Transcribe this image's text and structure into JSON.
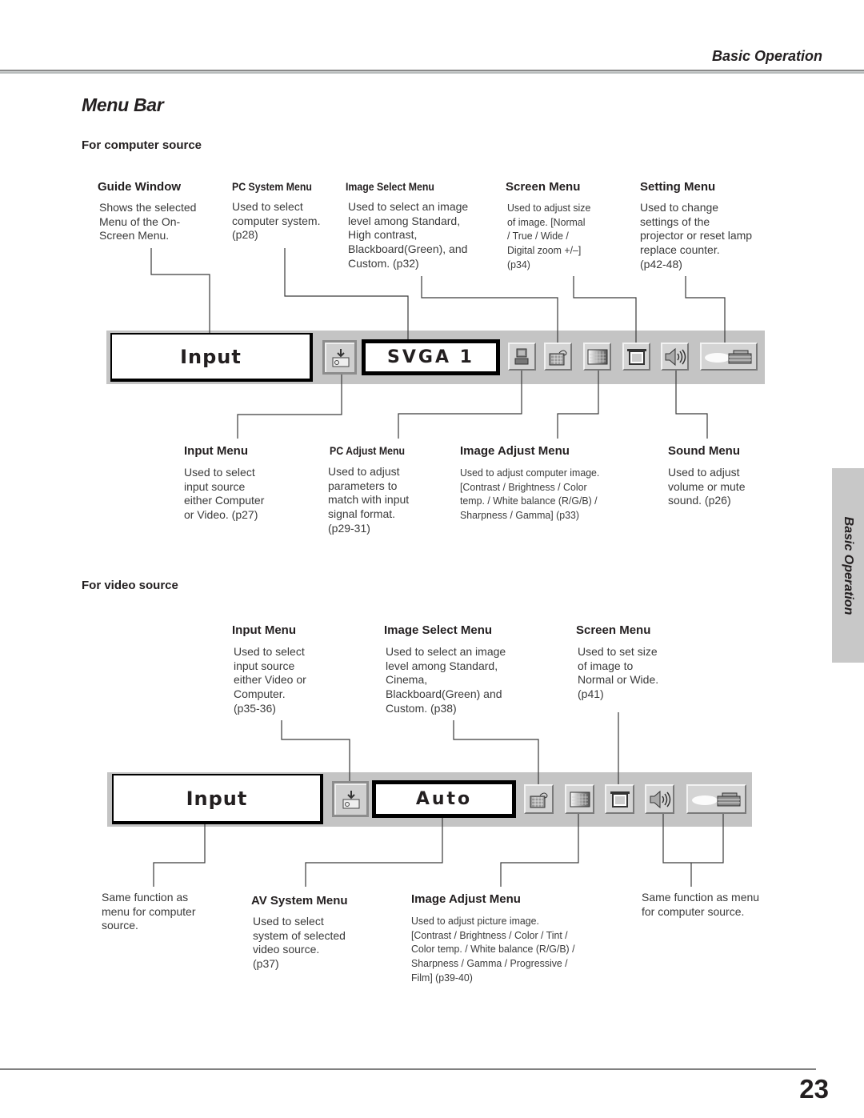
{
  "header": {
    "section": "Basic Operation"
  },
  "page_title": "Menu Bar",
  "side_tab": "Basic Operation",
  "page_number": "23",
  "computer": {
    "title": "For computer source",
    "top_items": [
      {
        "heading": "Guide Window",
        "desc": "Shows the selected\nMenu of the On-\nScreen Menu."
      },
      {
        "heading": "PC System Menu",
        "desc": "Used to select\ncomputer system.\n(p28)"
      },
      {
        "heading": "Image Select Menu",
        "desc": "Used to select  an image\nlevel among Standard,\nHigh contrast,\nBlackboard(Green), and\nCustom.  (p32)"
      },
      {
        "heading": "Screen Menu",
        "desc": "Used to adjust size\nof image.  [Normal\n/ True / Wide /\nDigital zoom +/–]\n(p34)"
      },
      {
        "heading": "Setting Menu",
        "desc": "Used to change\nsettings of the\nprojector or reset  lamp\nreplace counter.\n(p42-48)"
      }
    ],
    "bottom_items": [
      {
        "heading": "Input Menu",
        "desc": "Used to select\ninput source\neither Computer\nor Video.  (p27)"
      },
      {
        "heading": "PC Adjust Menu",
        "desc": "Used to adjust\nparameters to\nmatch with input\nsignal format.\n(p29-31)"
      },
      {
        "heading": "Image Adjust Menu",
        "desc": "Used to adjust computer image.\n[Contrast / Brightness / Color\ntemp. /  White balance (R/G/B) /\nSharpness /  Gamma]   (p33)"
      },
      {
        "heading": "Sound Menu",
        "desc": "Used to adjust\nvolume or mute\nsound.  (p26)"
      }
    ],
    "menubar": {
      "guide_label": "Input",
      "value_label": "SVGA  1",
      "icons": [
        "input-icon",
        "pc-adjust-icon",
        "image-select-icon",
        "image-adjust-icon",
        "screen-icon",
        "sound-icon",
        "setting-icon"
      ]
    }
  },
  "video": {
    "title": "For video source",
    "top_items": [
      {
        "heading": "Input Menu",
        "desc": "Used to select\ninput source\neither Video or\nComputer.\n(p35-36)"
      },
      {
        "heading": "Image Select Menu",
        "desc": "Used to select an image\nlevel among Standard,\nCinema,\nBlackboard(Green) and\nCustom.  (p38)"
      },
      {
        "heading": "Screen Menu",
        "desc": "Used to set size\nof image to\nNormal or Wide.\n(p41)"
      }
    ],
    "bottom_items": [
      {
        "heading": "",
        "desc": "Same function as\nmenu for computer\nsource."
      },
      {
        "heading": "AV System Menu",
        "desc": "Used to select\nsystem of selected\nvideo source.\n(p37)"
      },
      {
        "heading": "Image Adjust Menu",
        "desc": " Used to adjust picture image.\n[Contrast / Brightness / Color / Tint /\nColor temp. / White balance (R/G/B) /\nSharpness / Gamma / Progressive /\nFilm]  (p39-40)"
      },
      {
        "heading": "",
        "desc": "Same function as menu\nfor computer source."
      }
    ],
    "menubar": {
      "guide_label": "Input",
      "value_label": "Auto",
      "icons": [
        "input-icon",
        "image-select-icon",
        "image-adjust-icon",
        "screen-icon",
        "sound-icon",
        "setting-icon"
      ]
    }
  }
}
